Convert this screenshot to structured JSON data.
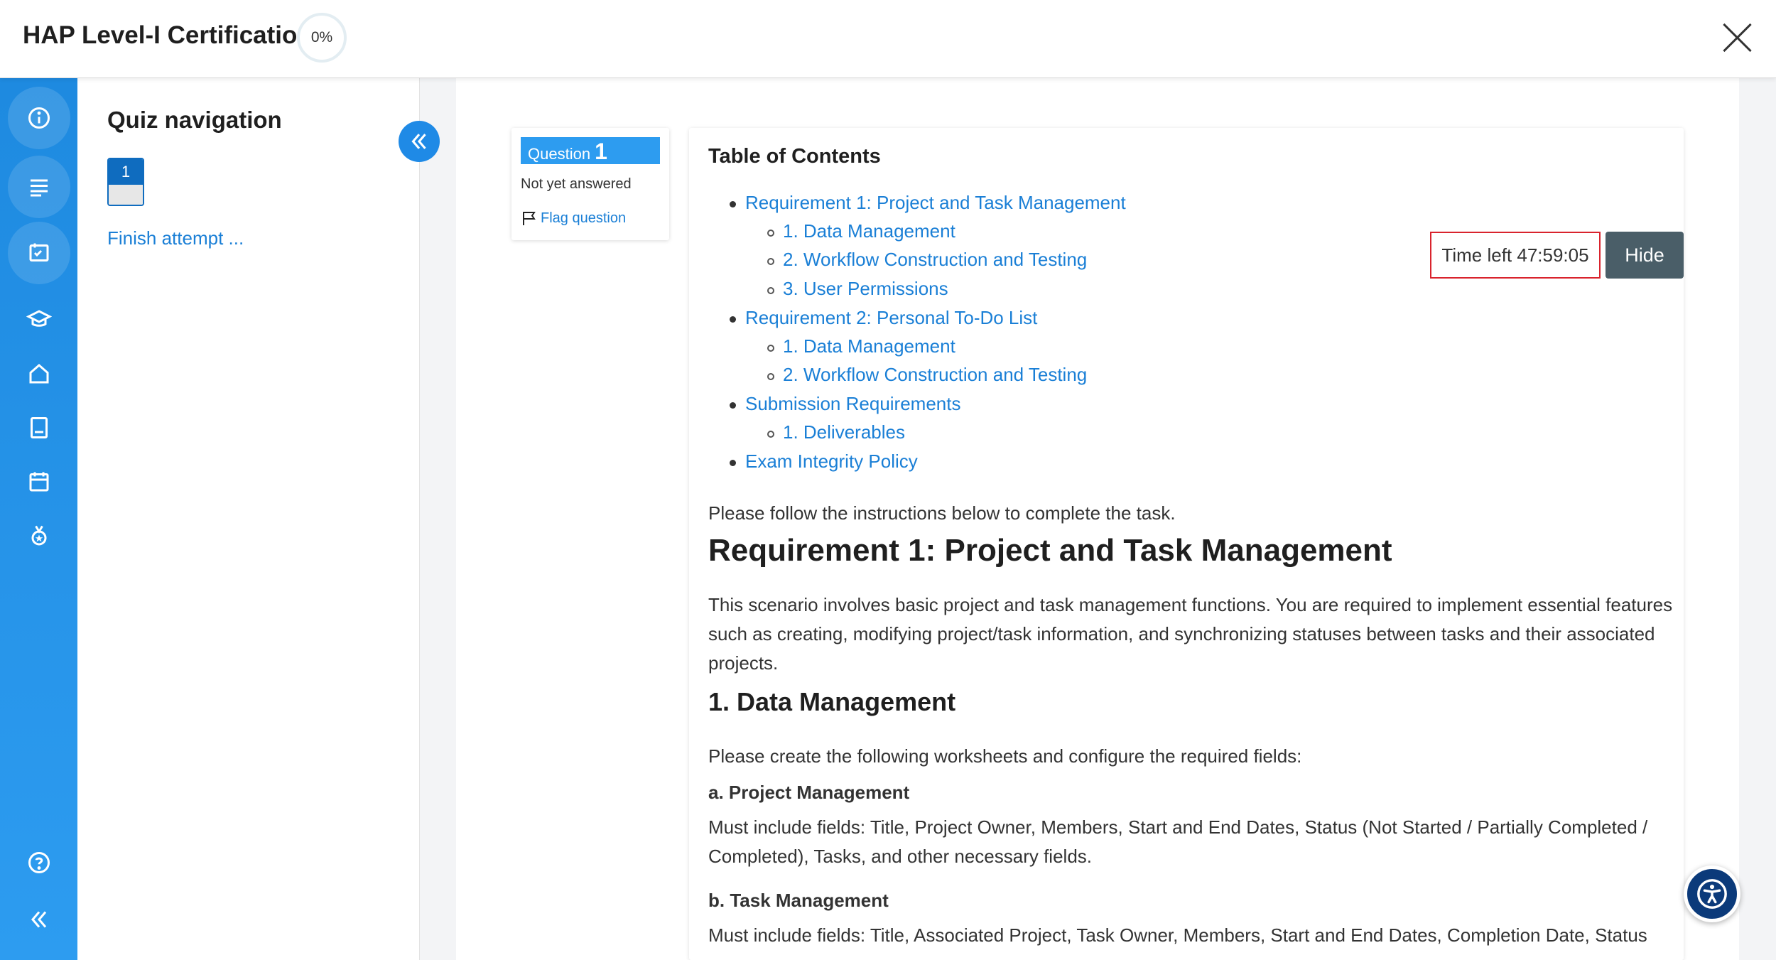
{
  "header": {
    "title": "HAP Level-I Certification",
    "progress": "0%"
  },
  "rail": {
    "icons": [
      "info-icon",
      "list-icon",
      "exam-icon",
      "graduation-cap-icon",
      "home-icon",
      "book-icon",
      "calendar-icon",
      "medal-icon",
      "help-icon",
      "collapse-icon"
    ]
  },
  "quiz_nav": {
    "title": "Quiz navigation",
    "question_number": "1",
    "finish_link": "Finish attempt ..."
  },
  "question_info": {
    "label": "Question",
    "number": "1",
    "state": "Not yet answered",
    "flag_label": "Flag question"
  },
  "timer": {
    "text": "Time left 47:59:05",
    "hide_label": "Hide"
  },
  "content": {
    "toc_title": "Table of Contents",
    "toc": [
      {
        "level": 1,
        "label": "Requirement 1: Project and Task Management"
      },
      {
        "level": 2,
        "label": "1. Data Management"
      },
      {
        "level": 2,
        "label": "2. Workflow Construction and Testing"
      },
      {
        "level": 2,
        "label": "3. User Permissions"
      },
      {
        "level": 1,
        "label": "Requirement 2: Personal To-Do List"
      },
      {
        "level": 2,
        "label": "1. Data Management"
      },
      {
        "level": 2,
        "label": "2. Workflow Construction and Testing"
      },
      {
        "level": 1,
        "label": "Submission Requirements"
      },
      {
        "level": 2,
        "label": "1. Deliverables"
      },
      {
        "level": 1,
        "label": "Exam Integrity Policy"
      }
    ],
    "intro": "Please follow the instructions below to complete the task.",
    "req1_heading": "Requirement 1: Project and Task Management",
    "req1_body": "This scenario involves basic project and task management functions. You are required to implement essential features such as creating, modifying project/task information, and synchronizing statuses between tasks and their associated projects.",
    "dm_heading": "1. Data Management",
    "dm_intro": "Please create the following worksheets and configure the required fields:",
    "pm_heading": "a. Project Management",
    "pm_body": "Must include fields: Title, Project Owner, Members, Start and End Dates, Status (Not Started / Partially Completed / Completed), Tasks, and other necessary fields.",
    "tm_heading": "b. Task Management",
    "tm_body": "Must include fields: Title, Associated Project, Task Owner, Members, Start and End Dates, Completion Date, Status"
  }
}
